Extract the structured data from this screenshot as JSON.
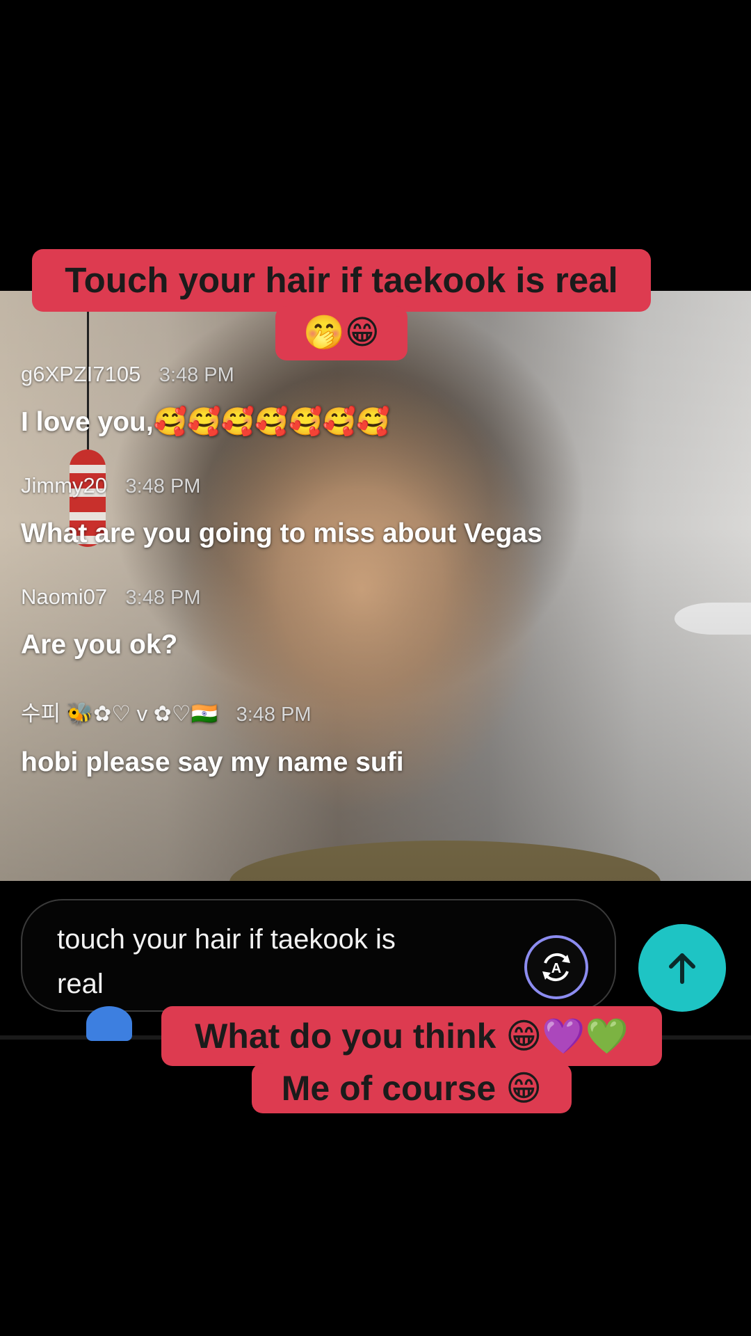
{
  "overlay_captions": {
    "top_line1": "Touch your hair if taekook is real",
    "top_line2": "🤭😁",
    "bottom_line1": "What do you think 😁💜💚",
    "bottom_line2": "Me of course 😁"
  },
  "chat": {
    "messages": [
      {
        "user": "g6XPZI7105",
        "time": "3:48 PM",
        "text": "I love you,🥰🥰🥰🥰🥰🥰🥰"
      },
      {
        "user": "Jimmy20",
        "time": "3:48 PM",
        "text": "What are you going to miss about Vegas"
      },
      {
        "user": "Naomi07",
        "time": "3:48 PM",
        "text": "Are you ok?"
      },
      {
        "user": "수피 🐝✿♡ v ✿♡🇮🇳",
        "time": "3:48 PM",
        "text": "hobi please say my name sufi"
      }
    ]
  },
  "input": {
    "value": "touch your hair if taekook is real"
  },
  "icons": {
    "translate": "translate-icon",
    "send": "arrow-up-icon"
  },
  "colors": {
    "caption_bg": "#dd3b50",
    "send_button": "#1ec4c4",
    "translate_ring": "#8c8cf0"
  }
}
